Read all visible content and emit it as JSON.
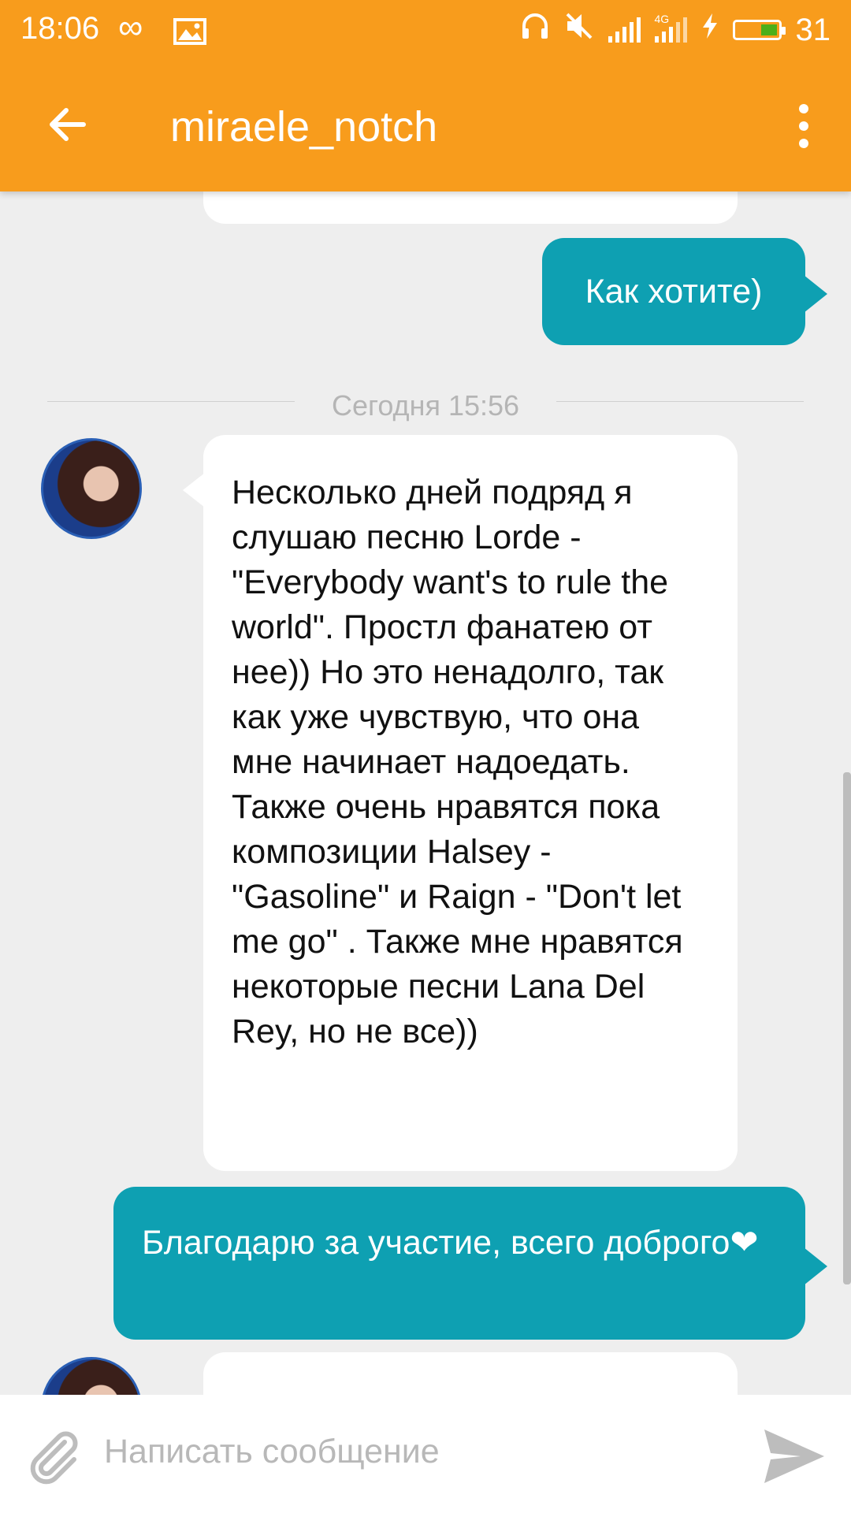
{
  "status_bar": {
    "time": "18:06",
    "battery": "31",
    "network": "4G"
  },
  "app_bar": {
    "title": "miraele_notch"
  },
  "messages": [
    {
      "type": "outgoing",
      "text": "Как хотите)"
    },
    {
      "type": "date_separator",
      "text": "Сегодня 15:56"
    },
    {
      "type": "incoming",
      "text": "Несколько дней подряд я слушаю песню Lorde - \"Everybody want's to rule the world\". Простл фанатею от нее)) Но это ненадолго, так как уже чувствую, что она мне начинает надоедать. Также очень нравятся пока композиции Halsey - \"Gasoline\" и Raign - \"Don't let me go\" . Также мне нравятся некоторые песни Lana Del Rey, но не все))"
    },
    {
      "type": "outgoing",
      "text": "Благодарю за участие, всего доброго❤"
    }
  ],
  "compose": {
    "placeholder": "Написать сообщение"
  },
  "colors": {
    "accent": "#f89c1c",
    "outgoing_bubble": "#0ea0b2",
    "incoming_bubble": "#ffffff",
    "background": "#eeeeee",
    "battery_fill": "#4caf1a"
  },
  "icons": [
    "back-arrow-icon",
    "more-vert-icon",
    "attach-icon",
    "send-icon",
    "headphones-icon",
    "mute-icon",
    "signal-icon",
    "infinity-icon",
    "gallery-icon",
    "charging-icon",
    "battery-icon"
  ]
}
